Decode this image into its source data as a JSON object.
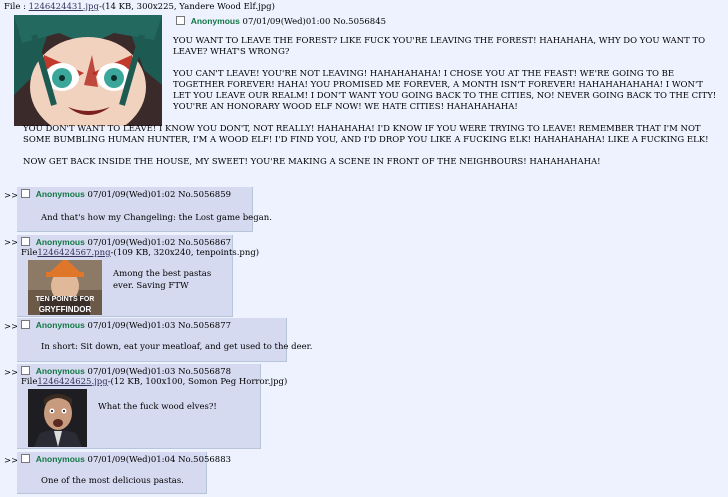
{
  "op": {
    "file_prefix": "File :",
    "file_link": "1246424431.jpg",
    "file_info": "-(14 KB, 300x225, Yandere Wood Elf.jpg)",
    "name": "Anonymous",
    "date": "07/01/09(Wed)01:00",
    "number": "No.5056845",
    "paragraphs": [
      "YOU WANT TO LEAVE THE FOREST? LIKE FUCK YOU'RE LEAVING THE FOREST! HAHAHAHA, WHY DO YOU WANT TO LEAVE? WHAT'S WRONG?",
      "YOU CAN'T LEAVE! YOU'RE NOT LEAVING! HAHAHAHAHA! I CHOSE YOU AT THE FEAST! WE'RE GOING TO BE TOGETHER FOREVER! HAHA! YOU PROMISED ME FOREVER, A MONTH ISN'T FOREVER! HAHAHAHAHAHA! I WON'T LET YOU LEAVE OUR REALM! I DON'T WANT YOU GOING BACK TO THE CITIES, NO! NEVER GOING BACK TO THE CITY! YOU'RE AN HONORARY WOOD ELF NOW! WE HATE CITIES! HAHAHAHAHA!",
      "YOU DON'T WANT TO LEAVE! I KNOW YOU DON'T, NOT REALLY! HAHAHAHA! I'D KNOW IF YOU WERE TRYING TO LEAVE! REMEMBER THAT I'M NOT SOME BUMBLING HUMAN HUNTER, I'M A WOOD ELF! I'D FIND YOU, AND I'D DROP YOU LIKE A FUCKING ELK! HAHAHAHAHA! LIKE A FUCKING ELK!",
      "NOW GET BACK INSIDE THE HOUSE, MY SWEET! YOU'RE MAKING A SCENE IN FRONT OF THE NEIGHBOURS! HAHAHAHAHA!"
    ]
  },
  "arrows": ">>",
  "replies": [
    {
      "name": "Anonymous",
      "date": "07/01/09(Wed)01:02",
      "number": "No.5056859",
      "text": "And that's how my Changeling: the Lost game began."
    },
    {
      "name": "Anonymous",
      "date": "07/01/09(Wed)01:02",
      "number": "No.5056867",
      "file_prefix": "File",
      "file_link": "1246424567.png",
      "file_info": "-(109 KB, 320x240, tenpoints.png)",
      "thumb_caption_1": "TEN POINTS FOR",
      "thumb_caption_2": "GRYFFINDOR",
      "text_1": "Among the best pastas",
      "text_2": "ever.  Saving FTW"
    },
    {
      "name": "Anonymous",
      "date": "07/01/09(Wed)01:03",
      "number": "No.5056877",
      "text": "In short: Sit down, eat your meatloaf, and get used to the deer."
    },
    {
      "name": "Anonymous",
      "date": "07/01/09(Wed)01:03",
      "number": "No.5056878",
      "file_prefix": "File",
      "file_link": "1246424625.jpg",
      "file_info": "-(12 KB, 100x100, Somon Peg Horror.jpg)",
      "text": "What the fuck wood elves?!"
    },
    {
      "name": "Anonymous",
      "date": "07/01/09(Wed)01:04",
      "number": "No.5056883",
      "text": "One of the most delicious pastas."
    }
  ]
}
